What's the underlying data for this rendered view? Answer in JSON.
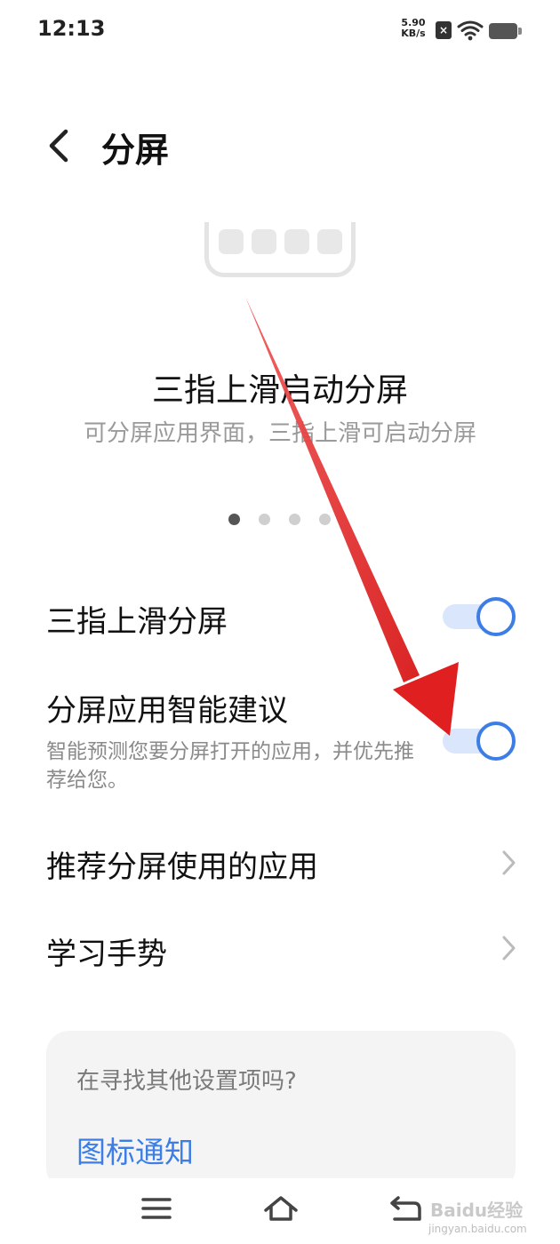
{
  "status_bar": {
    "time": "12:13",
    "net_speed_value": "5.90",
    "net_speed_unit": "KB/s",
    "sim_icon": "x-icon",
    "wifi_icon": "wifi-icon",
    "battery_icon": "battery-icon"
  },
  "header": {
    "back_icon": "chevron-left-icon",
    "title": "分屏"
  },
  "banner": {
    "title": "三指上滑启动分屏",
    "subtitle": "可分屏应用界面，三指上滑可启动分屏",
    "page_indicator": {
      "count": 4,
      "active": 1
    }
  },
  "settings": {
    "three_finger": {
      "label": "三指上滑分屏",
      "enabled": true
    },
    "smart_suggest": {
      "label": "分屏应用智能建议",
      "description": "智能预测您要分屏打开的应用，并优先推荐给您。",
      "enabled": true
    },
    "recommended_apps": {
      "label": "推荐分屏使用的应用"
    },
    "learn_gesture": {
      "label": "学习手势"
    }
  },
  "suggestion_card": {
    "title": "在寻找其他设置项吗?",
    "link": "图标通知"
  },
  "nav_bar": {
    "menu_icon": "menu-icon",
    "home_icon": "home-icon",
    "back_icon": "back-icon"
  },
  "watermark": {
    "text": "Baidu经验",
    "sub": "jingyan.baidu.com"
  },
  "colors": {
    "accent": "#3c7ee6",
    "annotation_arrow": "#e02020"
  }
}
